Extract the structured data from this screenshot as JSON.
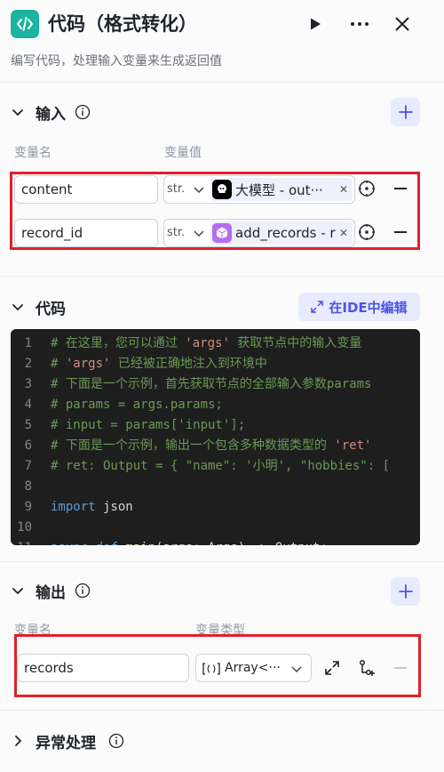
{
  "header": {
    "title": "代码（格式转化）",
    "subtitle": "编写代码，处理输入变量来生成返回值"
  },
  "input_section": {
    "title": "输入",
    "col_name": "变量名",
    "col_value": "变量值",
    "rows": [
      {
        "name": "content",
        "type": "str.",
        "ref_label": "大模型 - out···"
      },
      {
        "name": "record_id",
        "type": "str.",
        "ref_label": "add_records - r"
      }
    ]
  },
  "code_section": {
    "title": "代码",
    "ide_button": "在IDE中编辑",
    "lines": [
      {
        "n": "1",
        "parts": [
          [
            "cmt",
            "# 在这里，您可以通过 "
          ],
          [
            "str",
            "'args'"
          ],
          [
            "cmt",
            "  获取节点中的输入变量"
          ]
        ]
      },
      {
        "n": "2",
        "parts": [
          [
            "cmt",
            "# "
          ],
          [
            "str",
            "'args'"
          ],
          [
            "cmt",
            " 已经被正确地注入到环境中"
          ]
        ]
      },
      {
        "n": "3",
        "parts": [
          [
            "cmt",
            "# 下面是一个示例，首先获取节点的全部输入参数params"
          ]
        ]
      },
      {
        "n": "4",
        "parts": [
          [
            "cmt",
            "# params = args.params;"
          ]
        ]
      },
      {
        "n": "5",
        "parts": [
          [
            "cmt",
            "# input = params['input'];"
          ]
        ]
      },
      {
        "n": "6",
        "parts": [
          [
            "cmt",
            "# 下面是一个示例，输出一个包含多种数据类型的 "
          ],
          [
            "str",
            "'ret'"
          ]
        ]
      },
      {
        "n": "7",
        "parts": [
          [
            "cmt",
            "# ret: Output =  { \"name\": '小明', \"hobbies\": ["
          ]
        ]
      },
      {
        "n": "8",
        "parts": []
      },
      {
        "n": "9",
        "parts": [
          [
            "kw",
            "import"
          ],
          [
            "plain",
            " json"
          ]
        ]
      },
      {
        "n": "10",
        "parts": []
      },
      {
        "n": "11",
        "parts": [
          [
            "kw",
            "async"
          ],
          [
            "plain",
            " "
          ],
          [
            "kw",
            "def"
          ],
          [
            "plain",
            " "
          ],
          [
            "fn",
            "main"
          ],
          [
            "plain",
            "(args: Args) -> Output:"
          ]
        ]
      }
    ]
  },
  "output_section": {
    "title": "输出",
    "col_name": "变量名",
    "col_type": "变量类型",
    "rows": [
      {
        "name": "records",
        "type": "Array<···"
      }
    ]
  },
  "error_section": {
    "title": "异常处理"
  },
  "colors": {
    "accent": "#4d53e8",
    "brand_icon": "#1ab4a1",
    "highlight_box": "#e0202a"
  },
  "icons": {
    "app": "code-brackets-icon",
    "run": "play-icon",
    "more": "more-icon",
    "close": "close-icon"
  }
}
